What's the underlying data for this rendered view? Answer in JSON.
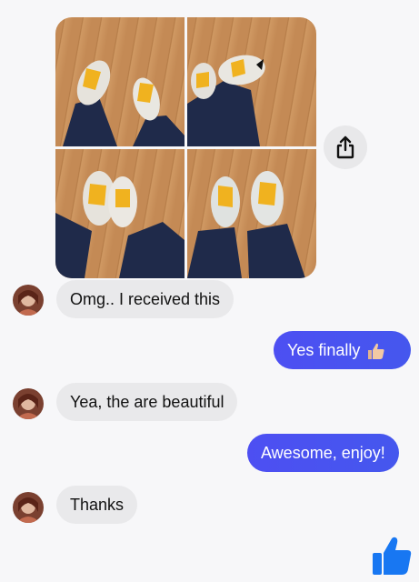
{
  "messages": [
    {
      "side": "in",
      "text": "Omg.. I received this"
    },
    {
      "side": "out",
      "text": "Yes finally",
      "emoji": "thumbs-up-emoji"
    },
    {
      "side": "in",
      "text": "Yea, the are beautiful"
    },
    {
      "side": "out",
      "text": "Awesome, enjoy!"
    },
    {
      "side": "in",
      "text": "Thanks"
    }
  ],
  "photos": [
    "sneakers-photo-1",
    "sneakers-photo-2",
    "sneakers-photo-3",
    "sneakers-photo-4"
  ],
  "icons": {
    "share": "share-icon",
    "like": "thumbs-up-icon"
  },
  "colors": {
    "background": "#f7f7f9",
    "incoming_bubble": "#e9e9eb",
    "outgoing_bubble": "#4a50f0",
    "like_icon": "#1877f2"
  }
}
